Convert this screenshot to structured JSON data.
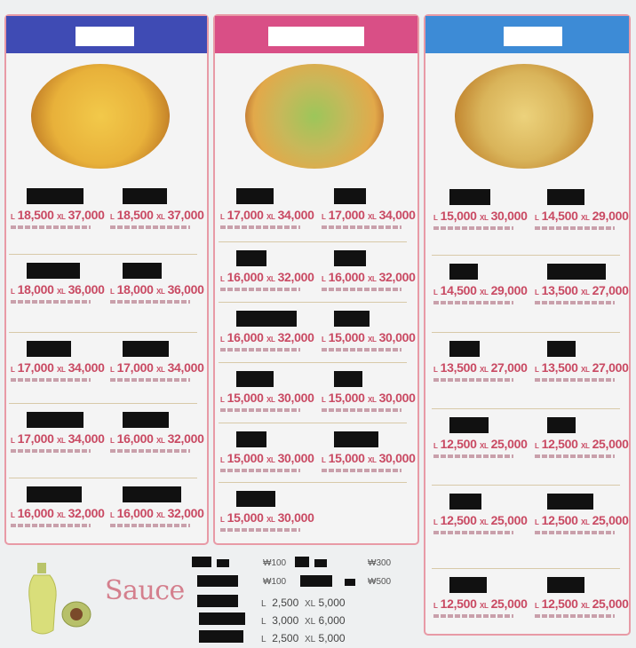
{
  "columns": [
    {
      "band_color": "#3f4bb4",
      "items": [
        {
          "prices": [
            "18,500",
            "37,000"
          ]
        },
        {
          "prices": [
            "18,500",
            "37,000"
          ]
        },
        {
          "prices": [
            "18,000",
            "36,000"
          ]
        },
        {
          "prices": [
            "18,000",
            "36,000"
          ]
        },
        {
          "prices": [
            "17,000",
            "34,000"
          ]
        },
        {
          "prices": [
            "17,000",
            "34,000"
          ]
        },
        {
          "prices": [
            "17,000",
            "34,000"
          ]
        },
        {
          "prices": [
            "16,000",
            "32,000"
          ]
        },
        {
          "prices": [
            "16,000",
            "32,000"
          ]
        },
        {
          "prices": [
            "16,000",
            "32,000"
          ]
        }
      ]
    },
    {
      "band_color": "#d94f86",
      "items": [
        {
          "prices": [
            "17,000",
            "34,000"
          ]
        },
        {
          "prices": [
            "17,000",
            "34,000"
          ]
        },
        {
          "prices": [
            "16,000",
            "32,000"
          ]
        },
        {
          "prices": [
            "16,000",
            "32,000"
          ]
        },
        {
          "prices": [
            "16,000",
            "32,000"
          ]
        },
        {
          "prices": [
            "15,000",
            "30,000"
          ]
        },
        {
          "prices": [
            "15,000",
            "30,000"
          ]
        },
        {
          "prices": [
            "15,000",
            "30,000"
          ]
        },
        {
          "prices": [
            "15,000",
            "30,000"
          ]
        },
        {
          "prices": [
            "15,000",
            "30,000"
          ]
        },
        {
          "prices": [
            "15,000",
            "30,000"
          ]
        }
      ]
    },
    {
      "band_color": "#3d8bd6",
      "items": [
        {
          "prices": [
            "15,000",
            "30,000"
          ]
        },
        {
          "prices": [
            "14,500",
            "29,000"
          ]
        },
        {
          "prices": [
            "14,500",
            "29,000"
          ]
        },
        {
          "prices": [
            "13,500",
            "27,000"
          ]
        },
        {
          "prices": [
            "13,500",
            "27,000"
          ]
        },
        {
          "prices": [
            "13,500",
            "27,000"
          ]
        },
        {
          "prices": [
            "12,500",
            "25,000"
          ]
        },
        {
          "prices": [
            "12,500",
            "25,000"
          ]
        },
        {
          "prices": [
            "12,500",
            "25,000"
          ]
        },
        {
          "prices": [
            "12,500",
            "25,000"
          ]
        },
        {
          "prices": [
            "12,500",
            "25,000"
          ]
        },
        {
          "prices": [
            "12,500",
            "25,000"
          ]
        }
      ]
    }
  ],
  "size_labels": {
    "large": "L",
    "xlarge": "XL"
  },
  "sauce": {
    "title": "Sauce",
    "prices": [
      "₩100",
      "₩300",
      "₩100",
      "₩500"
    ],
    "rows": [
      {
        "l": "2,500",
        "xl": "5,000"
      },
      {
        "l": "3,000",
        "xl": "6,000"
      },
      {
        "l": "2,500",
        "xl": "5,000"
      }
    ]
  }
}
